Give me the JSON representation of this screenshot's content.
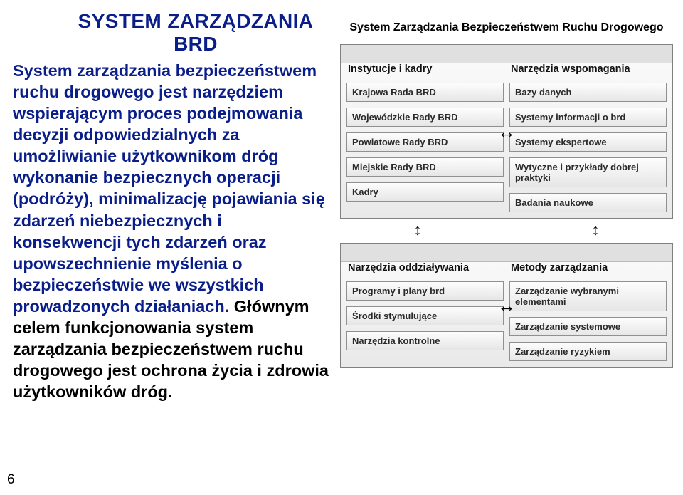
{
  "title": "SYSTEM ZARZĄDZANIA BRD",
  "paragraph_blue": "System zarządzania bezpieczeństwem ruchu drogowego jest narzędziem wspierającym proces podejmowania decyzji odpowiedzialnych za umożliwianie użytkownikom dróg wykonanie bezpiecznych operacji (podróży), minimalizację pojawiania się zdarzeń niebezpiecznych i konsekwencji tych zdarzeń oraz upowszechnienie myślenia o bezpieczeństwie we wszystkich prowadzonych działaniach.",
  "paragraph_black": "Głównym celem funkcjonowania system zarządzania bezpieczeństwem ruchu drogowego jest ochrona życia i zdrowia użytkowników dróg.",
  "page_number": "6",
  "diagram": {
    "title": "System Zarządzania Bezpieczeństwem Ruchu Drogowego",
    "top": {
      "left_header": "Instytucje i kadry",
      "right_header": "Narzędzia wspomagania",
      "left_items": [
        "Krajowa Rada BRD",
        "Wojewódzkie Rady BRD",
        "Powiatowe Rady BRD",
        "Miejskie Rady BRD",
        "Kadry"
      ],
      "right_items": [
        "Bazy danych",
        "Systemy informacji o brd",
        "Systemy ekspertowe",
        "Wytyczne i przykłady dobrej praktyki",
        "Badania naukowe"
      ]
    },
    "bottom": {
      "left_header": "Narzędzia oddziaływania",
      "right_header": "Metody zarządzania",
      "left_items": [
        "Programy i plany brd",
        "Środki stymulujące",
        "Narzędzia kontrolne"
      ],
      "right_items": [
        "Zarządzanie wybranymi elementami",
        "Zarządzanie systemowe",
        "Zarządzanie ryzykiem"
      ]
    }
  }
}
